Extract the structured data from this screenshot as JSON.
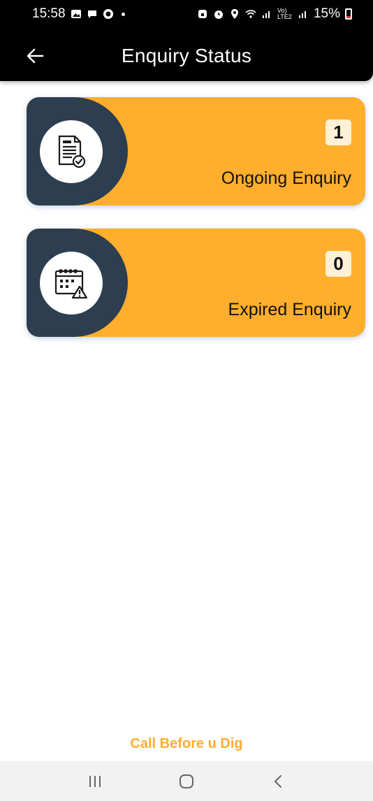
{
  "status_bar": {
    "time": "15:58",
    "battery": "15%",
    "signal_label": "Vo) LTE2"
  },
  "header": {
    "title": "Enquiry Status",
    "back_icon": "arrow-left-icon"
  },
  "cards": [
    {
      "count": "1",
      "label": "Ongoing Enquiry",
      "icon": "document-check-icon"
    },
    {
      "count": "0",
      "label": "Expired Enquiry",
      "icon": "calendar-warning-icon"
    }
  ],
  "footer": {
    "brand": "Call Before u Dig"
  },
  "nav": {
    "recents_icon": "recents-icon",
    "home_icon": "home-icon",
    "back_icon": "back-chevron-icon"
  },
  "colors": {
    "accent": "#FFAE2E",
    "dark": "#2C3E50",
    "header": "#000000",
    "count_bg": "#FFF0D6"
  }
}
